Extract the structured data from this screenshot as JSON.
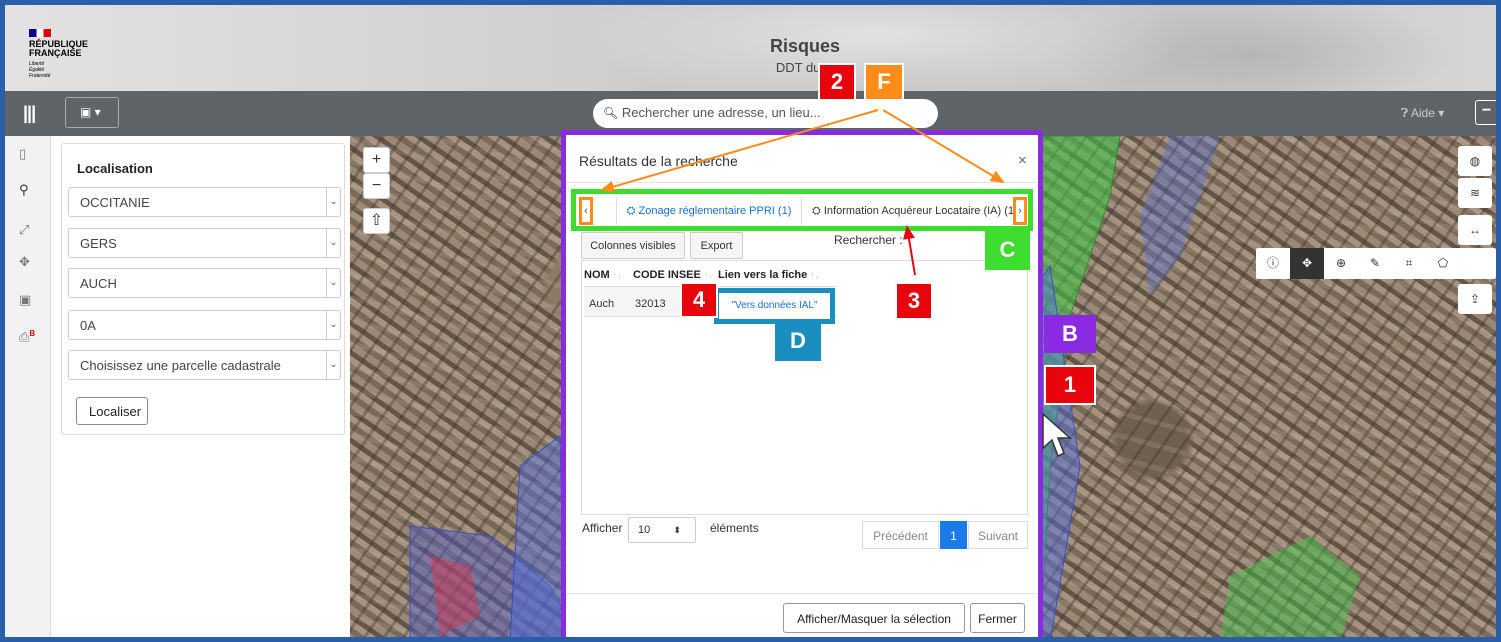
{
  "header": {
    "logo_lines": [
      "RÉPUBLIQUE",
      "FRANÇAISE"
    ],
    "logo_motto": [
      "Liberté",
      "Égalité",
      "Fraternité"
    ],
    "title": "Risques",
    "subtitle": "DDT du G"
  },
  "navbar": {
    "menu_icon": "|||",
    "search_placeholder": "Rechercher une adresse, un lieu...",
    "help_label": "Aide",
    "minimize_label": "−"
  },
  "sidebar": {
    "icons": [
      "map-icon",
      "location-pin-icon",
      "expand-icon",
      "crosshair-icon",
      "image-icon",
      "print-icon"
    ]
  },
  "localisation": {
    "title": "Localisation",
    "selects": [
      "OCCITANIE",
      "GERS",
      "AUCH",
      "0A",
      "Choisissez une parcelle cadastrale"
    ],
    "button": "Localiser"
  },
  "map_controls": {
    "zoom_in": "+",
    "zoom_out": "−",
    "north": "⇧"
  },
  "modal": {
    "title": "Résultats de la recherche",
    "close": "×",
    "tab_prev": "‹",
    "tab_next": "›",
    "tabs": [
      {
        "label": "Zonage réglementaire PPRI (1)",
        "active": true
      },
      {
        "label": "Information Acquéreur Locataire (IA) (1)",
        "active": false
      }
    ],
    "buttons": {
      "columns": "Colonnes visibles",
      "export": "Export"
    },
    "search_label": "Rechercher :",
    "table": {
      "columns": [
        "NOM",
        "CODE INSEE",
        "Lien vers la fiche"
      ],
      "rows": [
        {
          "nom": "Auch",
          "insee": "32013",
          "lien": "\"Vers données IAL\""
        }
      ]
    },
    "length_label_pre": "Afficher",
    "length_value": "10",
    "length_label_post": "éléments",
    "pagination": {
      "prev": "Précédent",
      "current": "1",
      "next": "Suivant"
    },
    "footer": {
      "toggle": "Afficher/Masquer la sélection",
      "close": "Fermer"
    }
  },
  "annotations": {
    "n1": "1",
    "n2": "2",
    "n3": "3",
    "n4": "4",
    "B": "B",
    "C": "C",
    "D": "D",
    "F": "F"
  },
  "colors": {
    "frame": "#2a5ea8",
    "modal_border": "#8a2be2",
    "tabs_border": "#3ddc2f",
    "arrow_border": "#ff8c1a",
    "link_border": "#1a8fbf",
    "badge_red": "#e8040c"
  }
}
